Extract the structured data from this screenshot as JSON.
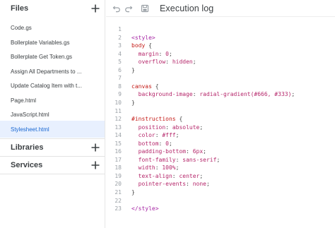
{
  "sidebar": {
    "files_title": "Files",
    "files": [
      {
        "label": "Code.gs",
        "active": false
      },
      {
        "label": "Bollerplate Variables.gs",
        "active": false
      },
      {
        "label": "Bollerplate Get Token.gs",
        "active": false
      },
      {
        "label": "Assign All Departments to ...",
        "active": false
      },
      {
        "label": "Update Catalog Item with t...",
        "active": false
      },
      {
        "label": "Page.html",
        "active": false
      },
      {
        "label": "JavaScript.html",
        "active": false
      },
      {
        "label": "Stylesheet.html",
        "active": true
      }
    ],
    "libraries_title": "Libraries",
    "services_title": "Services"
  },
  "toolbar": {
    "undo_icon": "undo-icon",
    "redo_icon": "redo-icon",
    "save_icon": "save-icon",
    "execution_log_label": "Execution log"
  },
  "editor": {
    "lines": [
      {
        "n": "1",
        "tokens": []
      },
      {
        "n": "2",
        "tokens": [
          {
            "t": "<style>",
            "c": "tag"
          }
        ]
      },
      {
        "n": "3",
        "tokens": [
          {
            "t": "body",
            "c": "sel"
          },
          {
            "t": " {",
            "c": "punc"
          }
        ]
      },
      {
        "n": "4",
        "tokens": [
          {
            "t": "  margin",
            "c": "prop"
          },
          {
            "t": ": ",
            "c": "punc"
          },
          {
            "t": "0",
            "c": "val"
          },
          {
            "t": ";",
            "c": "punc"
          }
        ]
      },
      {
        "n": "5",
        "tokens": [
          {
            "t": "  overflow",
            "c": "prop"
          },
          {
            "t": ": ",
            "c": "punc"
          },
          {
            "t": "hidden",
            "c": "val"
          },
          {
            "t": ";",
            "c": "punc"
          }
        ]
      },
      {
        "n": "6",
        "tokens": [
          {
            "t": "}",
            "c": "punc"
          }
        ]
      },
      {
        "n": "7",
        "tokens": []
      },
      {
        "n": "8",
        "tokens": [
          {
            "t": "canvas",
            "c": "sel"
          },
          {
            "t": " {",
            "c": "punc"
          }
        ]
      },
      {
        "n": "9",
        "tokens": [
          {
            "t": "  background-image",
            "c": "prop"
          },
          {
            "t": ": ",
            "c": "punc"
          },
          {
            "t": "radial-gradient(#666, #333)",
            "c": "val"
          },
          {
            "t": ";",
            "c": "punc"
          }
        ]
      },
      {
        "n": "10",
        "tokens": [
          {
            "t": "}",
            "c": "punc"
          }
        ]
      },
      {
        "n": "11",
        "tokens": []
      },
      {
        "n": "12",
        "tokens": [
          {
            "t": "#instructions",
            "c": "sel"
          },
          {
            "t": " {",
            "c": "punc"
          }
        ]
      },
      {
        "n": "13",
        "tokens": [
          {
            "t": "  position",
            "c": "prop"
          },
          {
            "t": ": ",
            "c": "punc"
          },
          {
            "t": "absolute",
            "c": "val"
          },
          {
            "t": ";",
            "c": "punc"
          }
        ]
      },
      {
        "n": "14",
        "tokens": [
          {
            "t": "  color",
            "c": "prop"
          },
          {
            "t": ": ",
            "c": "punc"
          },
          {
            "t": "#fff",
            "c": "val"
          },
          {
            "t": ";",
            "c": "punc"
          }
        ]
      },
      {
        "n": "15",
        "tokens": [
          {
            "t": "  bottom",
            "c": "prop"
          },
          {
            "t": ": ",
            "c": "punc"
          },
          {
            "t": "0",
            "c": "val"
          },
          {
            "t": ";",
            "c": "punc"
          }
        ]
      },
      {
        "n": "16",
        "tokens": [
          {
            "t": "  padding-bottom",
            "c": "prop"
          },
          {
            "t": ": ",
            "c": "punc"
          },
          {
            "t": "6px",
            "c": "val"
          },
          {
            "t": ";",
            "c": "punc"
          }
        ]
      },
      {
        "n": "17",
        "tokens": [
          {
            "t": "  font-family",
            "c": "prop"
          },
          {
            "t": ": ",
            "c": "punc"
          },
          {
            "t": "sans-serif",
            "c": "val"
          },
          {
            "t": ";",
            "c": "punc"
          }
        ]
      },
      {
        "n": "18",
        "tokens": [
          {
            "t": "  width",
            "c": "prop"
          },
          {
            "t": ": ",
            "c": "punc"
          },
          {
            "t": "100%",
            "c": "val"
          },
          {
            "t": ";",
            "c": "punc"
          }
        ]
      },
      {
        "n": "19",
        "tokens": [
          {
            "t": "  text-align",
            "c": "prop"
          },
          {
            "t": ": ",
            "c": "punc"
          },
          {
            "t": "center",
            "c": "val"
          },
          {
            "t": ";",
            "c": "punc"
          }
        ]
      },
      {
        "n": "20",
        "tokens": [
          {
            "t": "  pointer-events",
            "c": "prop"
          },
          {
            "t": ": ",
            "c": "punc"
          },
          {
            "t": "none",
            "c": "val"
          },
          {
            "t": ";",
            "c": "punc"
          }
        ]
      },
      {
        "n": "21",
        "tokens": [
          {
            "t": "}",
            "c": "punc"
          }
        ]
      },
      {
        "n": "22",
        "tokens": []
      },
      {
        "n": "23",
        "tokens": [
          {
            "t": "</style>",
            "c": "tag"
          }
        ]
      }
    ]
  }
}
